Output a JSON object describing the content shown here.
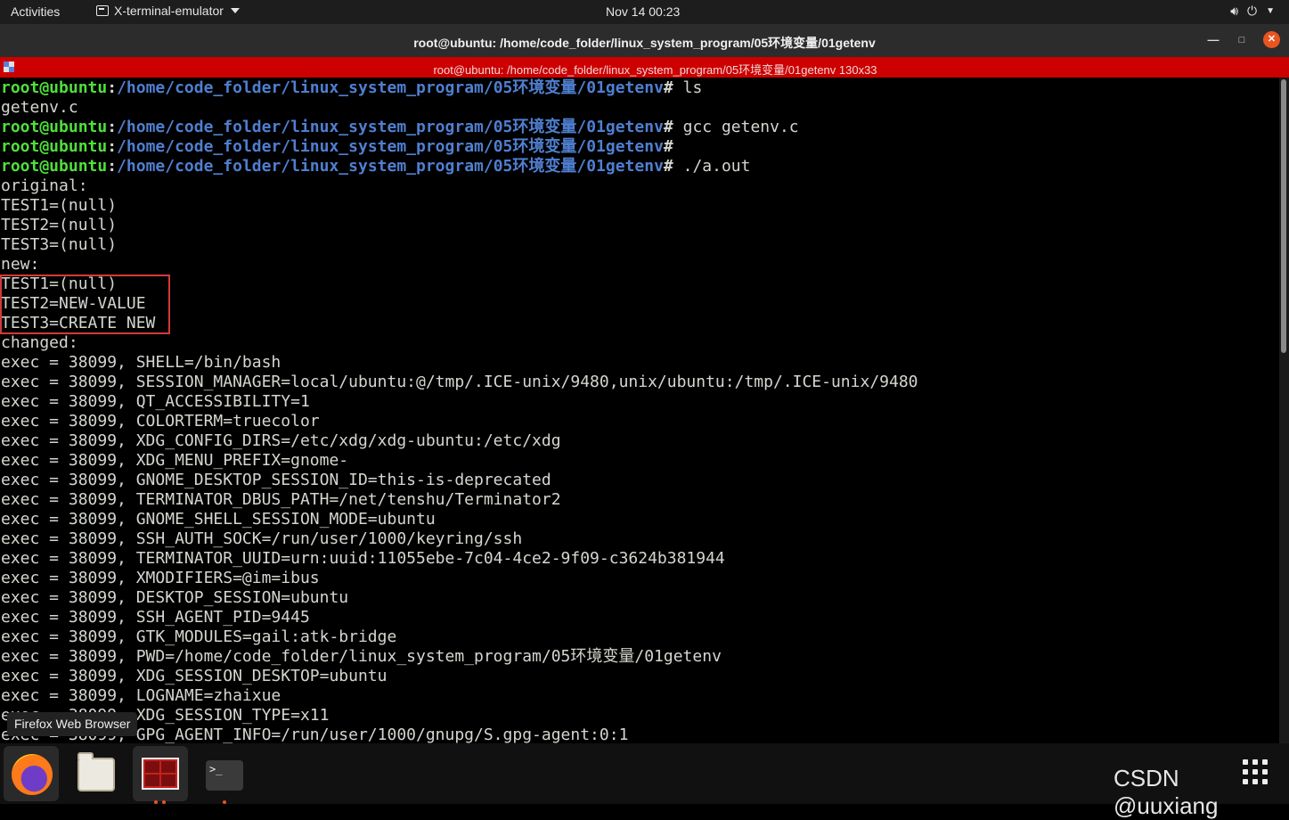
{
  "topbar": {
    "activities": "Activities",
    "app_menu_label": "X-terminal-emulator",
    "clock": "Nov 14  00:23"
  },
  "window": {
    "title": "root@ubuntu: /home/code_folder/linux_system_program/05环境变量/01getenv"
  },
  "terminator": {
    "title": "root@ubuntu: /home/code_folder/linux_system_program/05环境变量/01getenv 130x33"
  },
  "prompt": {
    "user": "root@ubuntu",
    "sep": ":",
    "path": "/home/code_folder/linux_system_program/05环境变量/01getenv",
    "suffix": "#"
  },
  "terminal": {
    "lines": [
      {
        "kind": "prompt",
        "cmd": " ls"
      },
      {
        "kind": "out",
        "text": "getenv.c"
      },
      {
        "kind": "prompt",
        "cmd": " gcc getenv.c"
      },
      {
        "kind": "prompt",
        "cmd": ""
      },
      {
        "kind": "prompt",
        "cmd": " ./a.out"
      },
      {
        "kind": "out",
        "text": "original:"
      },
      {
        "kind": "out",
        "text": "TEST1=(null)"
      },
      {
        "kind": "out",
        "text": "TEST2=(null)"
      },
      {
        "kind": "out",
        "text": "TEST3=(null)"
      },
      {
        "kind": "out",
        "text": "new:"
      },
      {
        "kind": "out",
        "text": "TEST1=(null)"
      },
      {
        "kind": "out",
        "text": "TEST2=NEW-VALUE"
      },
      {
        "kind": "out",
        "text": "TEST3=CREATE NEW"
      },
      {
        "kind": "out",
        "text": "changed:"
      },
      {
        "kind": "out",
        "text": "exec = 38099, SHELL=/bin/bash"
      },
      {
        "kind": "out",
        "text": "exec = 38099, SESSION_MANAGER=local/ubuntu:@/tmp/.ICE-unix/9480,unix/ubuntu:/tmp/.ICE-unix/9480"
      },
      {
        "kind": "out",
        "text": "exec = 38099, QT_ACCESSIBILITY=1"
      },
      {
        "kind": "out",
        "text": "exec = 38099, COLORTERM=truecolor"
      },
      {
        "kind": "out",
        "text": "exec = 38099, XDG_CONFIG_DIRS=/etc/xdg/xdg-ubuntu:/etc/xdg"
      },
      {
        "kind": "out",
        "text": "exec = 38099, XDG_MENU_PREFIX=gnome-"
      },
      {
        "kind": "out",
        "text": "exec = 38099, GNOME_DESKTOP_SESSION_ID=this-is-deprecated"
      },
      {
        "kind": "out",
        "text": "exec = 38099, TERMINATOR_DBUS_PATH=/net/tenshu/Terminator2"
      },
      {
        "kind": "out",
        "text": "exec = 38099, GNOME_SHELL_SESSION_MODE=ubuntu"
      },
      {
        "kind": "out",
        "text": "exec = 38099, SSH_AUTH_SOCK=/run/user/1000/keyring/ssh"
      },
      {
        "kind": "out",
        "text": "exec = 38099, TERMINATOR_UUID=urn:uuid:11055ebe-7c04-4ce2-9f09-c3624b381944"
      },
      {
        "kind": "out",
        "text": "exec = 38099, XMODIFIERS=@im=ibus"
      },
      {
        "kind": "out",
        "text": "exec = 38099, DESKTOP_SESSION=ubuntu"
      },
      {
        "kind": "out",
        "text": "exec = 38099, SSH_AGENT_PID=9445"
      },
      {
        "kind": "out",
        "text": "exec = 38099, GTK_MODULES=gail:atk-bridge"
      },
      {
        "kind": "out",
        "text": "exec = 38099, PWD=/home/code_folder/linux_system_program/05环境变量/01getenv"
      },
      {
        "kind": "out",
        "text": "exec = 38099, XDG_SESSION_DESKTOP=ubuntu"
      },
      {
        "kind": "out",
        "text": "exec = 38099, LOGNAME=zhaixue"
      },
      {
        "kind": "out",
        "text": "exec = 38099, XDG_SESSION_TYPE=x11"
      },
      {
        "kind": "out",
        "text": "exec = 38099, GPG_AGENT_INFO=/run/user/1000/gnupg/S.gpg-agent:0:1"
      }
    ]
  },
  "tooltip": {
    "text": "Firefox Web Browser"
  },
  "dock": {
    "items": [
      {
        "name": "firefox",
        "icon": "firefox-icon"
      },
      {
        "name": "files",
        "icon": "folder-icon"
      },
      {
        "name": "terminator",
        "icon": "terminator-icon"
      },
      {
        "name": "terminal",
        "icon": "terminal-icon",
        "glyph": ">_"
      }
    ]
  },
  "watermark": {
    "text": "CSDN @uuxiang"
  },
  "colors": {
    "prompt_user": "#4fe03a",
    "prompt_path": "#4f7fd0",
    "terminator_bar": "#cc0000",
    "highlight": "#d43a3a",
    "accent": "#e95420"
  }
}
